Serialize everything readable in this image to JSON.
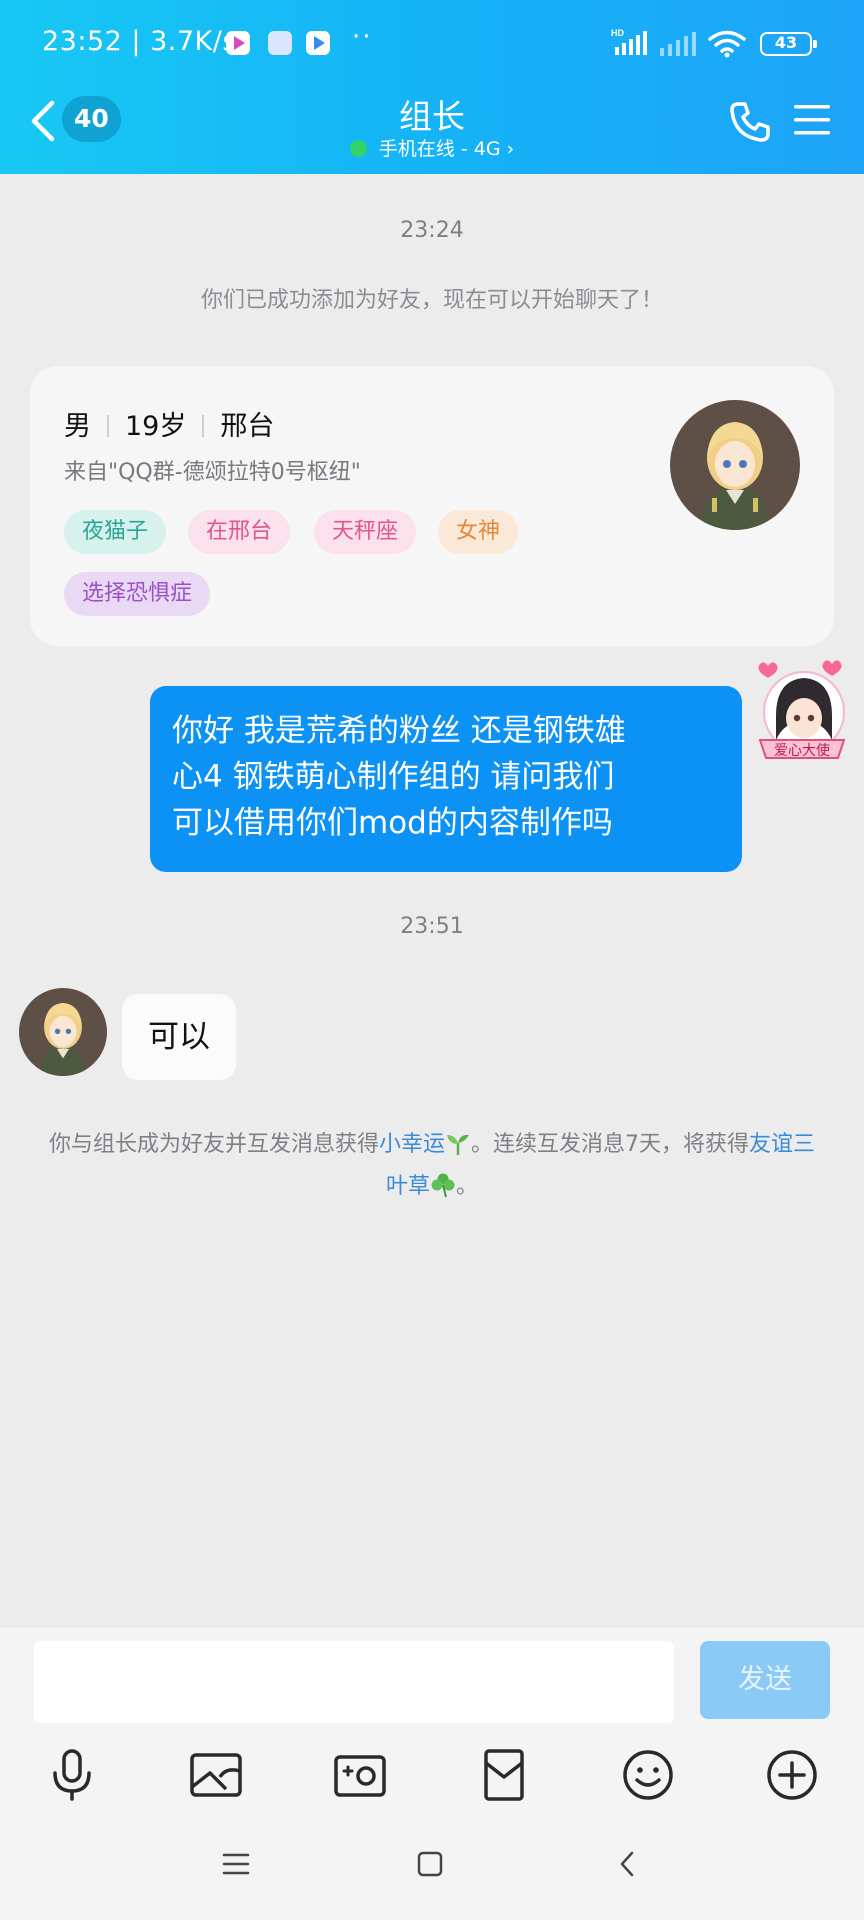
{
  "status_bar": {
    "time": "23:52",
    "speed": "3.7K/s",
    "hd_label": "HD",
    "battery": "43"
  },
  "header": {
    "unread_count": "40",
    "title": "组长",
    "subtitle": "手机在线 - 4G"
  },
  "chat": {
    "timestamp_1": "23:24",
    "friend_added_notice": "你们已成功添加为好友，现在可以开始聊天了！",
    "profile_card": {
      "gender": "男",
      "age": "19岁",
      "city": "邢台",
      "source": "来自\"QQ群-德颂拉特0号枢纽\"",
      "tags": [
        "夜猫子",
        "在邢台",
        "天秤座",
        "女神",
        "选择恐惧症"
      ]
    },
    "my_message": {
      "lines": [
        "你好 我是荒希的粉丝 还是钢铁雄",
        "心4 钢铁萌心制作组的 请问我们",
        "可以借用你们mod的内容制作吗"
      ]
    },
    "my_avatar_caption": "爱心大使",
    "timestamp_2": "23:51",
    "their_message": "可以",
    "reward_notice": {
      "part1": "你与组长成为好友并互发消息获得",
      "link1": "小幸运",
      "part2": "。连续互发消息7天，将获得",
      "link2": "友谊三叶草",
      "part3": "。"
    }
  },
  "input_bar": {
    "send_label": "发送",
    "tools": [
      "microphone-icon",
      "image-icon",
      "camera-icon",
      "red-packet-icon",
      "emoji-icon",
      "plus-icon"
    ]
  },
  "colors": {
    "header_gradient_start": "#18c8f4",
    "header_gradient_end": "#1ea4f8",
    "my_bubble": "#0c92f4",
    "send_disabled": "#8bcaf5"
  }
}
